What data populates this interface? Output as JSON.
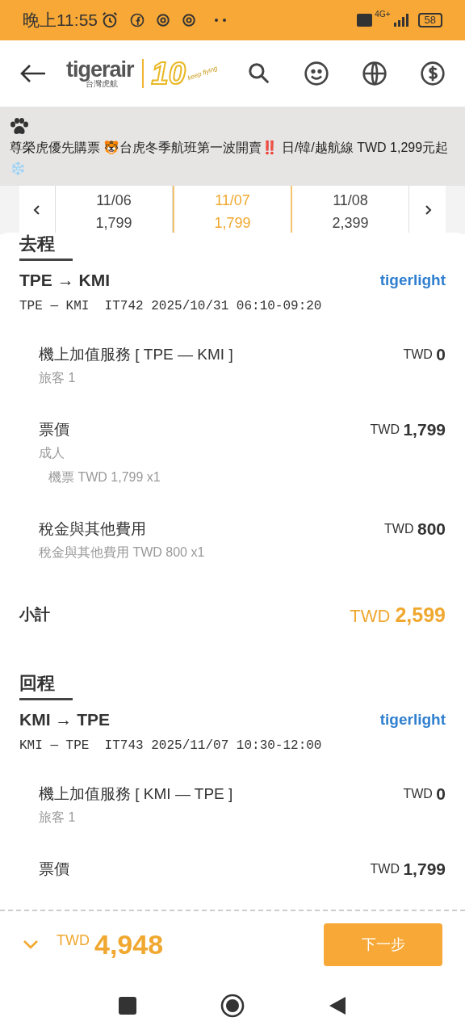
{
  "status_bar": {
    "time": "晚上11:55",
    "network": "4G+",
    "battery": "58"
  },
  "header": {
    "logo": {
      "brand": "tigerair",
      "subtitle": "台灣虎航",
      "anniversary": "10",
      "slogan": "keep flying"
    }
  },
  "banner": {
    "text": "尊榮虎優先購票 🐯台虎冬季航班第一波開賣‼️ 日/韓/越航線 TWD 1,299元起 ❄️"
  },
  "dates": [
    {
      "date": "11/06",
      "price": "1,799",
      "selected": false
    },
    {
      "date": "11/07",
      "price": "1,799",
      "selected": true
    },
    {
      "date": "11/08",
      "price": "2,399",
      "selected": false
    }
  ],
  "trips": [
    {
      "heading": "去程",
      "route": "TPE → KMI",
      "fare": "tigerlight",
      "flight": "TPE — KMI  IT742 2025/10/31 06:10-09:20",
      "items": [
        {
          "label": "機上加值服務 [ TPE — KMI ]",
          "currency": "TWD",
          "amount": "0",
          "details": [
            {
              "text": "旅客 1"
            }
          ]
        },
        {
          "label": "票價",
          "currency": "TWD",
          "amount": "1,799",
          "details": [
            {
              "text": "成人",
              "children": [
                {
                  "text": "機票 TWD 1,799 x1"
                }
              ]
            }
          ]
        },
        {
          "label": "稅金與其他費用",
          "currency": "TWD",
          "amount": "800",
          "details": [
            {
              "text": "稅金與其他費用 TWD 800 x1"
            }
          ]
        }
      ],
      "subtotal": {
        "label": "小計",
        "currency": "TWD",
        "amount": "2,599"
      }
    },
    {
      "heading": "回程",
      "route": "KMI → TPE",
      "fare": "tigerlight",
      "flight": "KMI — TPE  IT743 2025/11/07 10:30-12:00",
      "items": [
        {
          "label": "機上加值服務 [ KMI — TPE ]",
          "currency": "TWD",
          "amount": "0",
          "details": [
            {
              "text": "旅客 1"
            }
          ]
        },
        {
          "label": "票價",
          "currency": "TWD",
          "amount": "1,799"
        }
      ]
    }
  ],
  "footer": {
    "currency": "TWD",
    "total": "4,948",
    "button": "下一步"
  }
}
